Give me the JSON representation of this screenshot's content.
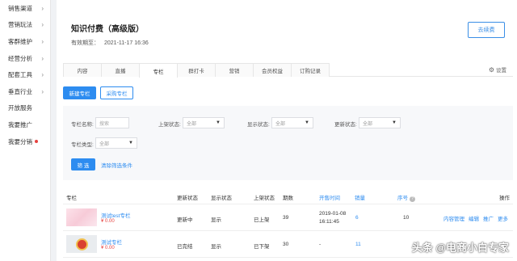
{
  "sidebar": {
    "items": [
      {
        "label": "销售渠道",
        "chevron": true,
        "dot": false
      },
      {
        "label": "营销玩法",
        "chevron": true,
        "dot": false
      },
      {
        "label": "客群维护",
        "chevron": true,
        "dot": false
      },
      {
        "label": "经营分析",
        "chevron": true,
        "dot": false
      },
      {
        "label": "配套工具",
        "chevron": true,
        "dot": false
      },
      {
        "label": "垂直行业",
        "chevron": true,
        "dot": false
      },
      {
        "label": "开放服务",
        "chevron": false,
        "dot": false
      },
      {
        "label": "我要推广",
        "chevron": false,
        "dot": false
      },
      {
        "label": "我要分销",
        "chevron": false,
        "dot": true
      }
    ]
  },
  "header": {
    "title": "知识付费（高级版）",
    "valid_label": "有效期至：",
    "valid_date": "2021-11-17 16:36",
    "renew_button": "去续费"
  },
  "tabs": [
    "内容",
    "直播",
    "专栏",
    "群打卡",
    "营销",
    "会员权益",
    "订购记录"
  ],
  "active_tab_index": 2,
  "settings_label": "设置",
  "actions": {
    "new_column": "新建专栏",
    "buy_column": "采购专栏"
  },
  "filters": {
    "name_label": "专栏名称:",
    "name_placeholder": "搜索",
    "shelf_label": "上架状态:",
    "shelf_value": "全部",
    "display_label": "显示状态:",
    "display_value": "全部",
    "update_label": "更新状态:",
    "update_value": "全部",
    "type_label": "专栏类型:",
    "type_value": "全部",
    "filter_button": "筛 选",
    "clear_link": "清除筛选条件"
  },
  "table": {
    "headers": {
      "column": "专栏",
      "update_status": "更新状态",
      "display_status": "显示状态",
      "shelf_status": "上架状态",
      "episodes": "期数",
      "sale_time": "开售时间",
      "sales": "销量",
      "order": "序号",
      "ops": "操作"
    },
    "rows": [
      {
        "title": "测试test专栏",
        "price": "¥ 0.00",
        "update_status": "更新中",
        "display_status": "显示",
        "shelf_status": "已上架",
        "episodes": "39",
        "sale_time_date": "2019-01-08",
        "sale_time_clock": "16:11:45",
        "sales": "6",
        "order": "10",
        "ops": [
          "内容管理",
          "编辑",
          "推广",
          "更多"
        ]
      },
      {
        "title": "测试专栏",
        "price": "¥ 0.00",
        "update_status": "已完结",
        "display_status": "显示",
        "shelf_status": "已下架",
        "episodes": "30",
        "sale_time_date": "-",
        "sale_time_clock": "",
        "sales": "11",
        "order": "",
        "ops": []
      }
    ]
  },
  "watermark": "头条 @电商小白专家",
  "colors": {
    "primary": "#2d8cf0",
    "price_red": "#e64340"
  }
}
